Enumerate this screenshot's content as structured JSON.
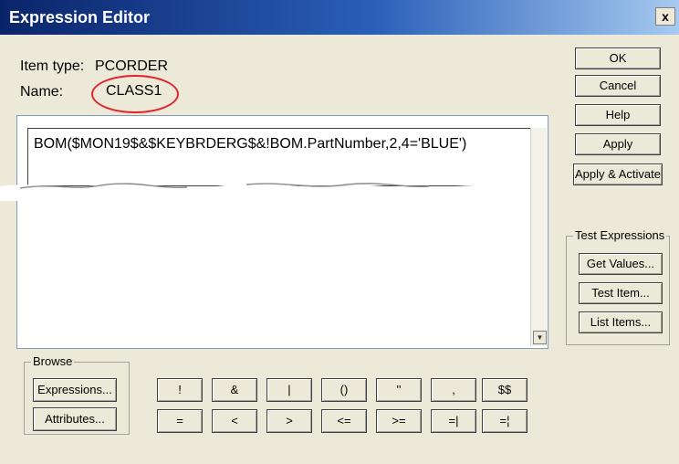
{
  "window": {
    "title": "Expression Editor",
    "close_label": "x"
  },
  "fields": {
    "item_type_label": "Item type:",
    "item_type_value": "PCORDER",
    "name_label": "Name:",
    "name_value": "CLASS1"
  },
  "editor": {
    "expression": "BOM($MON19$&$KEYBRDERG$&!BOM.PartNumber,2,4='BLUE')"
  },
  "side_buttons": {
    "ok": "OK",
    "cancel": "Cancel",
    "help": "Help",
    "apply": "Apply",
    "apply_activate": "Apply & Activate"
  },
  "test_expressions": {
    "label": "Test Expressions",
    "get_values": "Get Values...",
    "test_item": "Test Item...",
    "list_items": "List Items..."
  },
  "browse": {
    "label": "Browse",
    "expressions": "Expressions...",
    "attributes": "Attributes..."
  },
  "operators": {
    "row1": [
      "!",
      "&",
      "|",
      "()",
      "''",
      ",",
      "$$"
    ],
    "row2": [
      "=",
      "<",
      ">",
      "<=",
      ">=",
      "=|",
      "=¦"
    ]
  },
  "colors": {
    "title_start": "#0a246a",
    "title_end": "#a6caf0",
    "highlight_circle": "#e0242a",
    "dialog_bg": "#ece9d8"
  },
  "icons": {
    "close": "close-icon",
    "scroll_down": "scroll-down-arrow-icon"
  }
}
